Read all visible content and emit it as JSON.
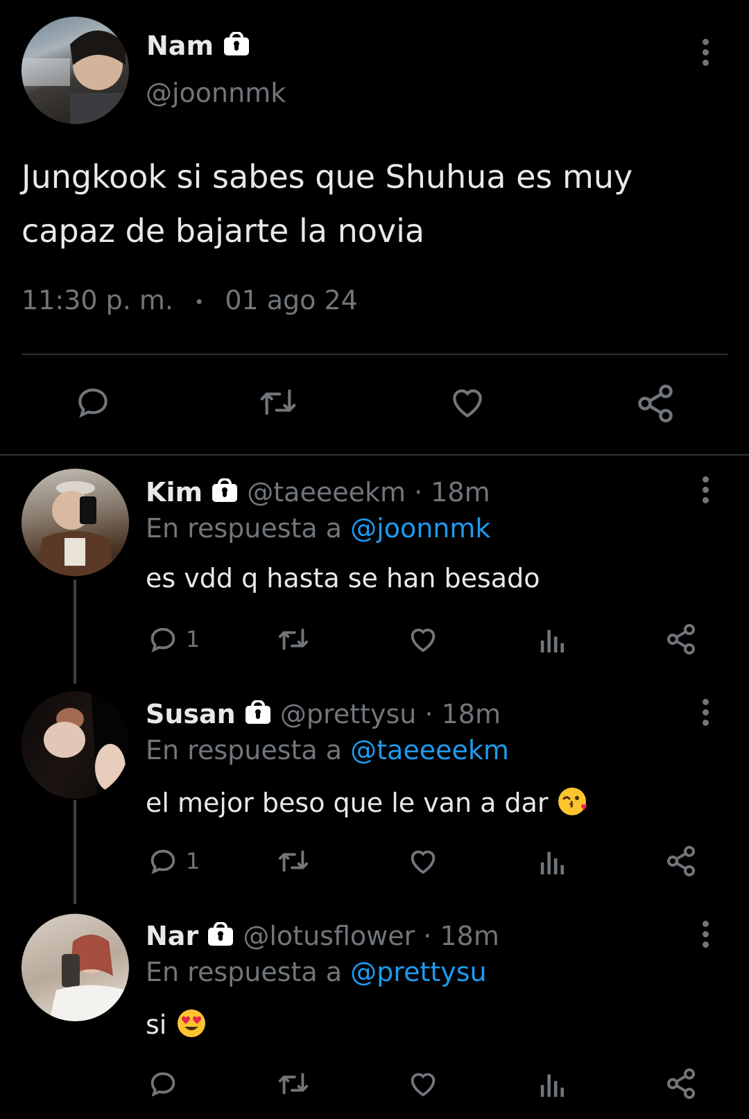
{
  "main_tweet": {
    "display_name": "Nam",
    "handle": "@joonnmk",
    "text_line1": "Jungkook si sabes que Shuhua es muy",
    "text_line2": "capaz de bajarte la novia",
    "time": "11:30 p. m.",
    "separator": "•",
    "date": "01 ago 24"
  },
  "replies": [
    {
      "display_name": "Kim",
      "meta": "@taeeeekm · 18m",
      "reply_prefix": "En respuesta a ",
      "reply_to": "@joonnmk",
      "text": "es vdd q hasta se han besado",
      "reply_count": "1",
      "emoji": ""
    },
    {
      "display_name": "Susan",
      "meta": "@prettysu · 18m",
      "reply_prefix": "En respuesta a ",
      "reply_to": "@taeeeekm",
      "text": "el mejor beso que le van a dar",
      "reply_count": "1",
      "emoji": "kiss-wink-emoji"
    },
    {
      "display_name": "Nar",
      "meta": "@lotusflower · 18m",
      "reply_prefix": "En respuesta a ",
      "reply_to": "@prettysu",
      "text": "si",
      "reply_count": "",
      "emoji": "heart-eyes-emoji"
    }
  ],
  "colors": {
    "background": "#000000",
    "text": "#e7e9ea",
    "muted": "#71767b",
    "link": "#1d9bf0",
    "divider": "#2f3336"
  }
}
